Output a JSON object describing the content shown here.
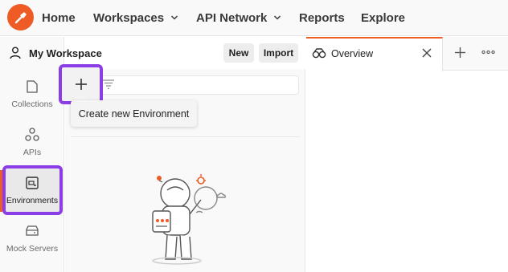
{
  "topnav": {
    "items": [
      {
        "label": "Home",
        "has_dropdown": false
      },
      {
        "label": "Workspaces",
        "has_dropdown": true
      },
      {
        "label": "API Network",
        "has_dropdown": true
      },
      {
        "label": "Reports",
        "has_dropdown": false
      },
      {
        "label": "Explore",
        "has_dropdown": false
      }
    ],
    "logo_icon": "postman-logo-icon",
    "brand_color": "#ef5b25"
  },
  "workspace": {
    "title": "My Workspace",
    "new_label": "New",
    "import_label": "Import"
  },
  "sidebar": {
    "items": [
      {
        "label": "Collections",
        "icon": "collections-icon"
      },
      {
        "label": "APIs",
        "icon": "apis-icon"
      },
      {
        "label": "Environments",
        "icon": "environments-icon",
        "active": true
      },
      {
        "label": "Mock Servers",
        "icon": "mock-servers-icon"
      }
    ]
  },
  "panel": {
    "add_icon": "plus-icon",
    "filter_icon": "filter-icon",
    "tooltip": "Create new Environment"
  },
  "tabs": {
    "items": [
      {
        "label": "Overview",
        "icon": "overview-icon",
        "active": true
      }
    ],
    "add_icon": "plus-icon",
    "more_icon": "more-icon"
  },
  "colors": {
    "highlight": "#8c3ee6",
    "accent": "#ef5b25"
  }
}
